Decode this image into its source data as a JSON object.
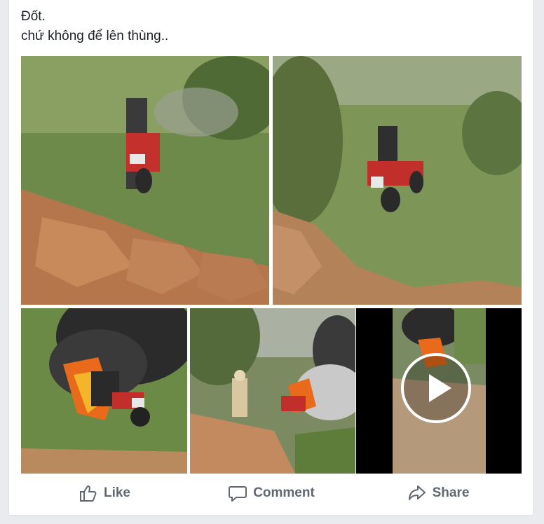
{
  "post": {
    "text_line1": "Đốt.",
    "text_line2": "chứ không để lên thùng.."
  },
  "photos": [
    {
      "name": "motorbike-near-rocks-photo"
    },
    {
      "name": "motorbike-in-grass-photo"
    },
    {
      "name": "motorbike-burning-photo"
    },
    {
      "name": "officer-at-burning-bike-photo"
    },
    {
      "name": "burning-bike-video-thumbnail"
    }
  ],
  "actions": {
    "like_label": "Like",
    "comment_label": "Comment",
    "share_label": "Share"
  },
  "colors": {
    "background": "#e9ebee",
    "card": "#ffffff",
    "action_text": "#606770",
    "post_text": "#1d2129"
  },
  "icons": {
    "like": "thumbs-up-icon",
    "comment": "speech-bubble-icon",
    "share": "share-arrow-icon",
    "play": "play-icon"
  }
}
